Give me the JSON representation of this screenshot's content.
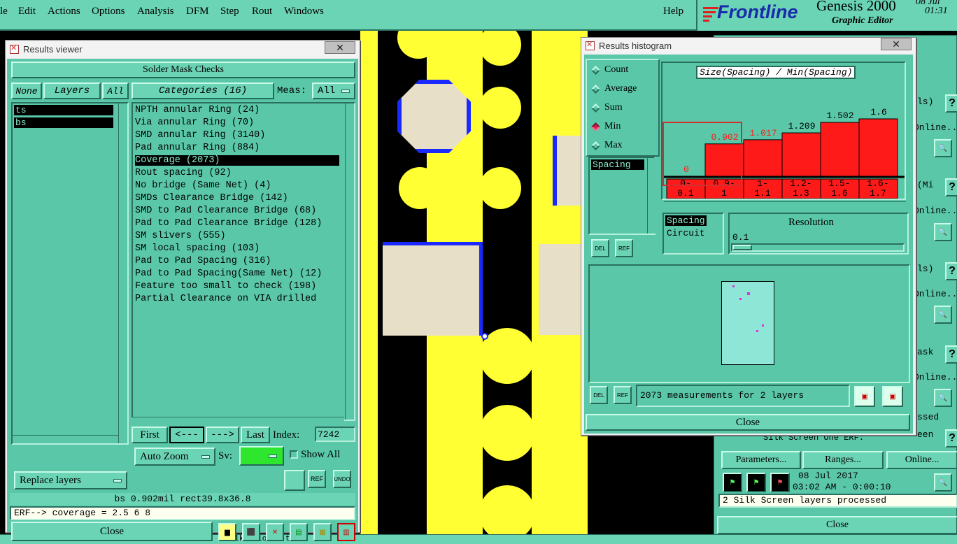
{
  "menubar": {
    "items": [
      "le",
      "Edit",
      "Actions",
      "Options",
      "Analysis",
      "DFM",
      "Step",
      "Rout",
      "Windows"
    ],
    "help": "Help"
  },
  "brand": {
    "logo": "Frontline",
    "product": "Genesis 2000",
    "subtitle": "Graphic Editor",
    "date": "08 Jul",
    "time": "01:31"
  },
  "results_viewer": {
    "window_title": "Results viewer",
    "header": "Solder Mask Checks",
    "none_btn": "None",
    "layers_btn": "Layers",
    "all_btn": "All",
    "layers": [
      "ts",
      "bs"
    ],
    "categories_header": "Categories (16)",
    "meas_label": "Meas:",
    "meas_value": "All",
    "categories": [
      "NPTH annular Ring (24)",
      "Via annular Ring (70)",
      "SMD annular Ring (3140)",
      "Pad annular Ring (884)",
      "Coverage (2073)",
      "Rout spacing (92)",
      "No bridge (Same Net) (4)",
      "SMDs Clearance Bridge (142)",
      "SMD to Pad Clearance Bridge (68)",
      "Pad to Pad Clearance Bridge (128)",
      "SM slivers (555)",
      "SM local spacing (103)",
      "Pad to Pad Spacing (316)",
      "Pad to Pad Spacing(Same Net) (12)",
      "Feature too small to check (198)",
      "Partial Clearance on VIA drilled"
    ],
    "selected_category_index": 4,
    "first_btn": "First",
    "prev_btn": "<---",
    "next_btn": "--->",
    "last_btn": "Last",
    "index_label": "Index:",
    "index_value": "7242",
    "auto_zoom": "Auto Zoom",
    "sv_label": "Sv:",
    "show_all": "Show All",
    "replace_layers": "Replace layers",
    "ref_label": "REF",
    "undo_label": "UNDO",
    "status": "bs 0.902mil   rect39.8x36.8",
    "erf": "ERF--> coverage = 2.5 6 8",
    "close": "Close"
  },
  "histogram": {
    "window_title": "Results histogram",
    "modes": [
      "Count",
      "Average",
      "Sum",
      "Min",
      "Max"
    ],
    "selected_mode": "Min",
    "measure_list": [
      "Spacing"
    ],
    "del_label": "DEL",
    "ref_label": "REF",
    "resolution_label": "Resolution",
    "resolution_value": "0.1",
    "type_list": [
      "Spacing",
      "Circuit"
    ],
    "status": "2073 measurements for 2 layers",
    "close": "Close"
  },
  "chart_data": {
    "type": "bar",
    "title": "Size(Spacing) / Min(Spacing)",
    "categories": [
      "0-\n0.1",
      "0.9-\n1",
      "1-\n1.1",
      "1.2-\n1.3",
      "1.5-\n1.6",
      "1.6-\n1.7"
    ],
    "values": [
      0,
      0.902,
      1.017,
      1.209,
      1.502,
      1.6
    ],
    "value_labels": [
      "0",
      "0.902",
      "1.017",
      "1.209",
      "1.502",
      "1.6"
    ],
    "ylim": [
      0,
      1.6
    ],
    "bar_color": "#ff1a1a"
  },
  "right_panel": {
    "labels": [
      "ls)",
      "Online...",
      "(Mi",
      "Online...",
      "ls)",
      "Online...",
      "ask",
      "Online...",
      "ssed",
      "een"
    ],
    "parameters_btn": "Parameters...",
    "ranges_btn": "Ranges...",
    "online_btn": "Online...",
    "silk_label": "Silk Screen One ERF:",
    "date": "08 Jul 2017",
    "time": "03:02 AM - 0:00:10",
    "status": "2 Silk Screen layers processed",
    "close": "Close"
  },
  "bottom_strip": {
    "text": "Silk-Solo-fi t"
  },
  "colors": {
    "panel": "#5ac8a8",
    "copper": "#ffff33",
    "mask_outline": "#1a2aff",
    "pad_fill": "#e8dfc8"
  }
}
